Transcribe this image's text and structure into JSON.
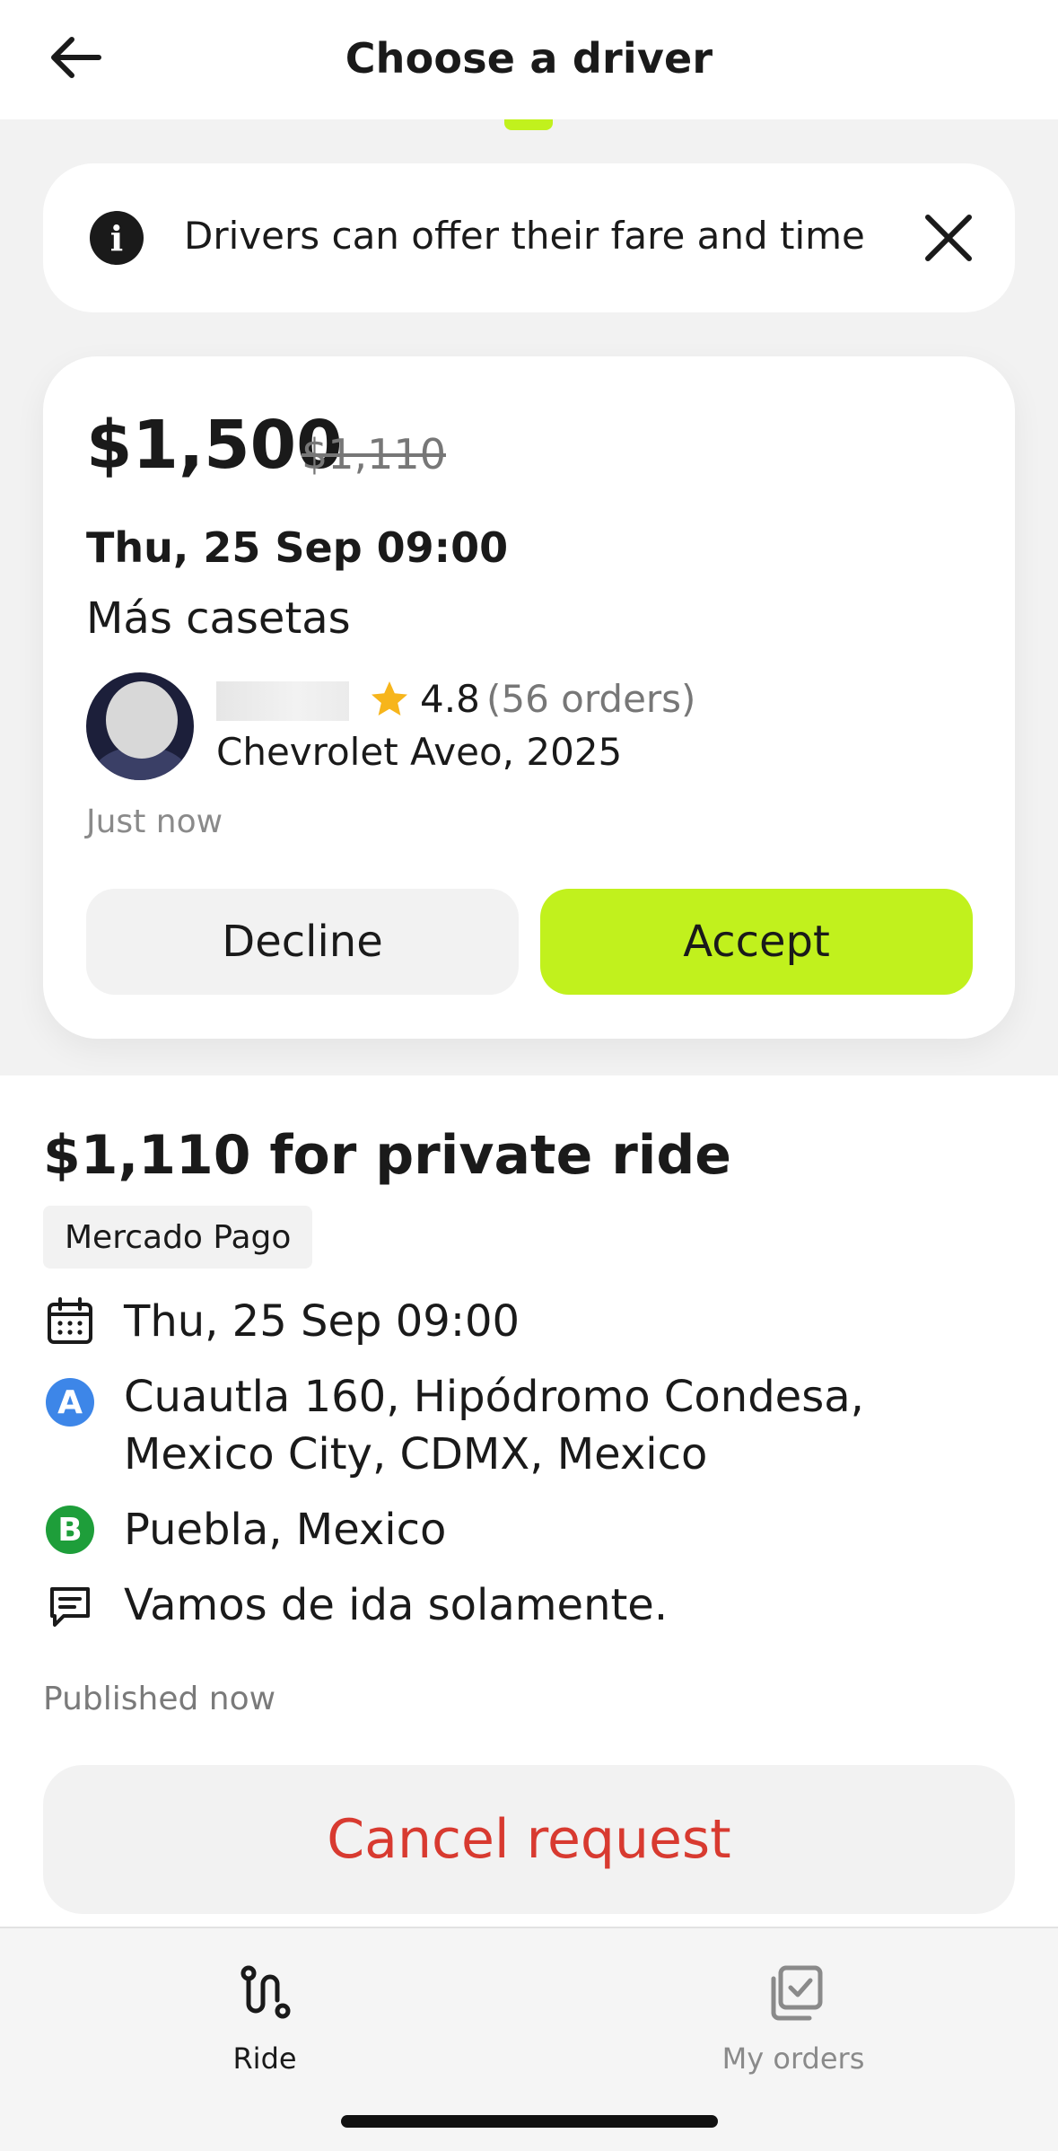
{
  "header": {
    "title": "Choose a driver"
  },
  "info_banner": {
    "text": "Drivers can offer their fare and time"
  },
  "offer": {
    "price": "$1,500",
    "original_price": "$1,110",
    "datetime": "Thu, 25 Sep 09:00",
    "note": "Más casetas",
    "driver": {
      "rating": "4.8",
      "orders": "(56 orders)",
      "car": "Chevrolet Aveo, 2025"
    },
    "time_ago": "Just now",
    "decline_label": "Decline",
    "accept_label": "Accept"
  },
  "request": {
    "title": "$1,110 for private ride",
    "payment_method": "Mercado Pago",
    "datetime": "Thu, 25 Sep 09:00",
    "pickup_marker": "A",
    "pickup": "Cuautla 160, Hipódromo Condesa, Mexico City, CDMX, Mexico",
    "dropoff_marker": "B",
    "dropoff": "Puebla, Mexico",
    "comment": "Vamos de ida solamente.",
    "published": "Published now",
    "cancel_label": "Cancel request"
  },
  "tabs": [
    {
      "label": "Ride",
      "icon": "route-icon",
      "active": true
    },
    {
      "label": "My orders",
      "icon": "orders-check-icon",
      "active": false
    }
  ],
  "colors": {
    "accent": "#c1f11d",
    "cancel": "#d83a30",
    "pickup": "#3d86e8",
    "dropoff": "#1e9e3a",
    "star": "#f7b51b"
  }
}
